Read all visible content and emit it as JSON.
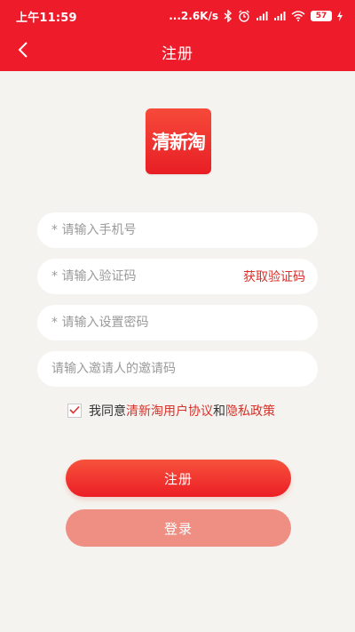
{
  "status_bar": {
    "time": "上午11:59",
    "network_speed": "...2.6K/s",
    "battery": "57",
    "icons": [
      "bluetooth-icon",
      "alarm-icon",
      "signal-icon",
      "signal-icon",
      "wifi-icon",
      "battery-icon",
      "charging-icon"
    ]
  },
  "header": {
    "title": "注册",
    "back_icon": "back-arrow-icon"
  },
  "logo": {
    "text": "清新淘",
    "colors": [
      "#f64a3a",
      "#e81e25"
    ]
  },
  "form": {
    "phone_placeholder": "* 请输入手机号",
    "code_placeholder": "* 请输入验证码",
    "get_code_label": "获取验证码",
    "password_placeholder": "* 请输入设置密码",
    "invite_placeholder": "请输入邀请人的邀请码"
  },
  "agreement": {
    "checked": true,
    "prefix": "我同意",
    "user_agreement": "清新淘用户协议",
    "conjunction": "和",
    "privacy_policy": "隐私政策"
  },
  "buttons": {
    "register_label": "注册",
    "login_label": "登录"
  },
  "colors": {
    "brand_red": "#ee1c2b",
    "link_red": "#d9312a",
    "login_button": "#ef8f83",
    "background": "#f5f3ef"
  }
}
